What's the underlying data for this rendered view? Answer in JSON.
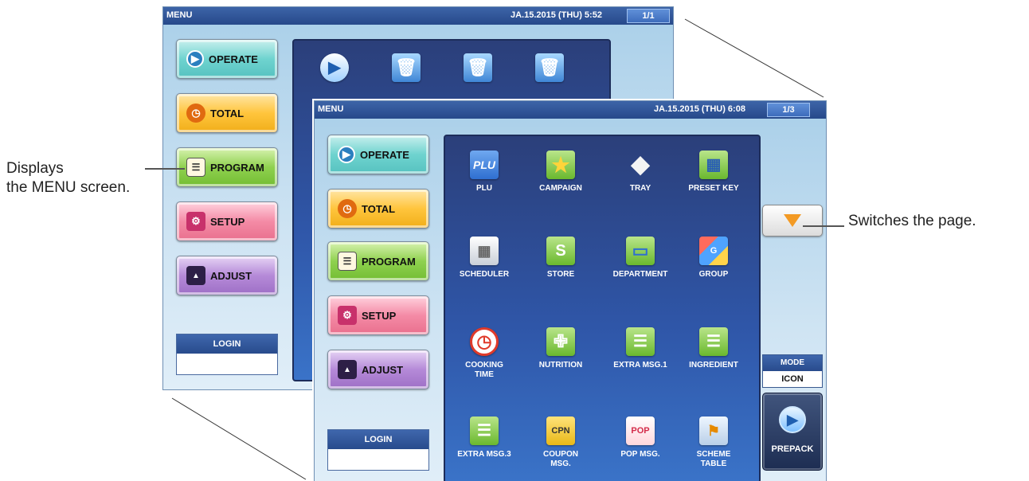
{
  "callouts": {
    "left_line1": "Displays",
    "left_line2": "the MENU screen.",
    "right": "Switches the page."
  },
  "back_screen": {
    "title": "MENU",
    "datetime": "JA.15.2015 (THU)  5:52",
    "page": "1/1",
    "menu": [
      "OPERATE",
      "TOTAL",
      "PROGRAM",
      "SETUP",
      "ADJUST"
    ],
    "login_label": "LOGIN",
    "icons": [
      "play-icon",
      "trash-icon",
      "trash-icon",
      "trash-icon"
    ]
  },
  "front_screen": {
    "title": "MENU",
    "datetime": "JA.15.2015 (THU)  6:08",
    "page": "1/3",
    "menu": [
      "OPERATE",
      "TOTAL",
      "PROGRAM",
      "SETUP",
      "ADJUST"
    ],
    "login_label": "LOGIN",
    "tiles": [
      {
        "label": "PLU",
        "icon": "plu-icon"
      },
      {
        "label": "CAMPAIGN",
        "icon": "star-icon"
      },
      {
        "label": "TRAY",
        "icon": "tray-icon"
      },
      {
        "label": "PRESET KEY",
        "icon": "preset-key-icon"
      },
      {
        "label": "SCHEDULER",
        "icon": "calendar-icon"
      },
      {
        "label": "STORE",
        "icon": "store-icon"
      },
      {
        "label": "DEPARTMENT",
        "icon": "folder-icon"
      },
      {
        "label": "GROUP",
        "icon": "group-icon"
      },
      {
        "label": "COOKING\nTIME",
        "icon": "clock-icon"
      },
      {
        "label": "NUTRITION",
        "icon": "cutlery-icon"
      },
      {
        "label": "EXTRA MSG.1",
        "icon": "message-icon"
      },
      {
        "label": "INGREDIENT",
        "icon": "message-icon"
      },
      {
        "label": "EXTRA MSG.3",
        "icon": "message-icon"
      },
      {
        "label": "COUPON\nMSG.",
        "icon": "coupon-icon"
      },
      {
        "label": "POP MSG.",
        "icon": "pop-icon"
      },
      {
        "label": "SCHEME\nTABLE",
        "icon": "map-icon"
      }
    ],
    "mode_label": "MODE",
    "mode_value": "ICON",
    "prepack_label": "PREPACK",
    "page_down_icon": "triangle-down-icon"
  },
  "colors": {
    "titlebar": "#27498a",
    "icon_panel": "#2f56a8",
    "page_arrow": "#f39a24"
  }
}
